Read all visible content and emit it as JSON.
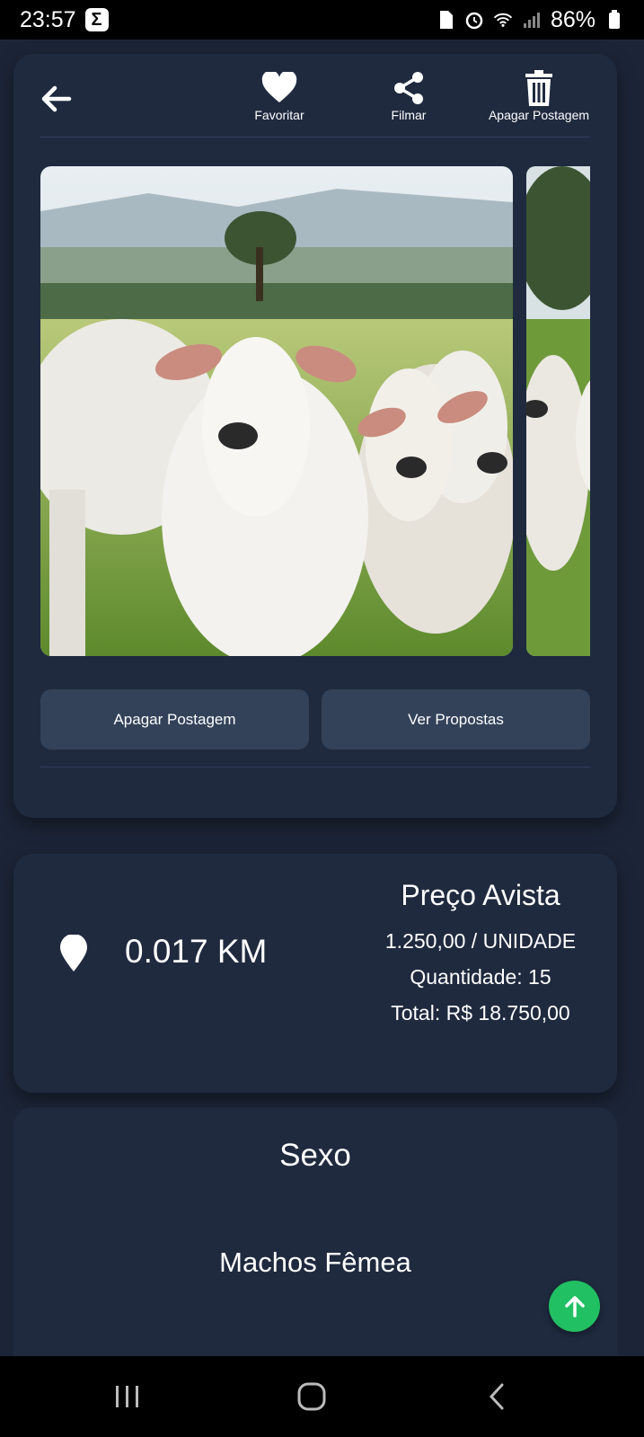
{
  "status_bar": {
    "time": "23:57",
    "app_badge": "Σ",
    "battery": "86%"
  },
  "toolbar": {
    "favorite_label": "Favoritar",
    "share_label": "Filmar",
    "delete_label": "Apagar Postagem"
  },
  "actions": {
    "delete_post": "Apagar Postagem",
    "view_proposals": "Ver Propostas"
  },
  "listing": {
    "distance": "0.017 KM",
    "price_title": "Preço Avista",
    "unit_price": "1.250,00 / UNIDADE",
    "quantity": "Quantidade: 15",
    "total": "Total: R$ 18.750,00"
  },
  "sex_section": {
    "title": "Sexo",
    "values": "Machos Fêmea"
  },
  "colors": {
    "background": "#1c2538",
    "card": "#1f2a3f",
    "button": "#334259",
    "fab": "#21c063"
  }
}
